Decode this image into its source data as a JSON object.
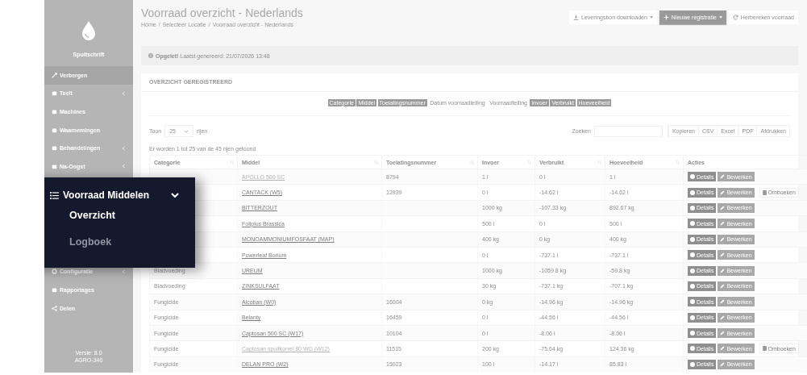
{
  "sidebar": {
    "app_name": "Spuitschrift",
    "items": [
      {
        "label": "Verbergen",
        "selected": true,
        "expandable": false
      },
      {
        "label": "Teelt",
        "selected": false,
        "expandable": true
      },
      {
        "label": "Machines",
        "selected": false,
        "expandable": false
      },
      {
        "label": "Waarnemingen",
        "selected": false,
        "expandable": false
      },
      {
        "label": "Behandelingen",
        "selected": false,
        "expandable": true
      },
      {
        "label": "Na-Oogst",
        "selected": false,
        "expandable": true
      },
      {
        "label": "Configuratie",
        "selected": false,
        "expandable": true
      },
      {
        "label": "Rapportages",
        "selected": false,
        "expandable": false
      },
      {
        "label": "Delen",
        "selected": false,
        "expandable": false
      }
    ],
    "version": "Versie: 8.0",
    "build": "AGRO-340"
  },
  "popup_menu": {
    "title": "Voorraad Middelen",
    "expanded": true,
    "items": [
      {
        "label": "Overzicht",
        "selected": true
      },
      {
        "label": "Logboek",
        "selected": false
      }
    ]
  },
  "page": {
    "title": "Voorraad overzicht - Nederlands",
    "breadcrumb_separator": "/",
    "breadcrumb": [
      "Home",
      "Selecteer Locatie",
      "Voorraad overzicht - Nederlands"
    ],
    "actions": [
      {
        "label": "Leveringsbon downloaden",
        "kind": "download"
      },
      {
        "label": "Nieuwe registratie",
        "kind": "new"
      },
      {
        "label": "Herbereken voorraad",
        "kind": "refresh"
      }
    ]
  },
  "alert": {
    "strong": "Opgelet!",
    "text": "Laatst genereerd: 21/07/2026 13:48"
  },
  "card": {
    "title": "OVERZICHT GEREGISTREERD",
    "column_toggles": [
      {
        "label": "Categorie",
        "on": true
      },
      {
        "label": "Middel",
        "on": true
      },
      {
        "label": "Toelatingsnummer",
        "on": true
      },
      {
        "label": "Datum voorraadtelling",
        "on": false
      },
      {
        "label": "Voorraadtelling",
        "on": false
      },
      {
        "label": "Invoer",
        "on": true
      },
      {
        "label": "Verbruikt",
        "on": true
      },
      {
        "label": "Hoeveelheid",
        "on": true
      }
    ],
    "length": {
      "prefix": "Toon",
      "value": "25",
      "suffix": "rijen"
    },
    "search": {
      "label": "Zoeken"
    },
    "exports": [
      "Kopieren",
      "CSV",
      "Excel",
      "PDF",
      "Afdrukken"
    ],
    "info": "Er worden 1 tot 25 van de 45 rijen getoond"
  },
  "table": {
    "columns": [
      "Categorie",
      "Middel",
      "Toelatingsnummer",
      "Invoer",
      "Verbruikt",
      "Hoeveelheid",
      "Acties"
    ],
    "rows": [
      {
        "categorie": "",
        "middel": "APOLLO 500 SC",
        "faded": true,
        "toelatingsnummer": "8794",
        "invoer": "1 l",
        "verbruikt": "0 l",
        "hoeveelheid": "1 l",
        "actions": [
          {
            "label": "Details",
            "kind": "details"
          },
          {
            "label": "Bewerken",
            "kind": "edit"
          }
        ]
      },
      {
        "categorie": "",
        "middel": "CANTACK (W5)",
        "faded": false,
        "toelatingsnummer": "12939",
        "invoer": "0 l",
        "verbruikt": "-14.62 l",
        "hoeveelheid": "-14.62 l",
        "actions": [
          {
            "label": "Details",
            "kind": "details"
          },
          {
            "label": "Bewerken",
            "kind": "edit"
          },
          {
            "label": "Omboeken",
            "kind": "transfer"
          }
        ]
      },
      {
        "categorie": "",
        "middel": "BITTERZOUT",
        "faded": false,
        "toelatingsnummer": "",
        "invoer": "1000 kg",
        "verbruikt": "-107.33 kg",
        "hoeveelheid": "892.67 kg",
        "actions": [
          {
            "label": "Details",
            "kind": "details"
          },
          {
            "label": "Bewerken",
            "kind": "edit"
          }
        ]
      },
      {
        "categorie": "",
        "middel": "Foliplus Brassica",
        "faded": false,
        "toelatingsnummer": "",
        "invoer": "500 l",
        "verbruikt": "0 l",
        "hoeveelheid": "500 l",
        "actions": [
          {
            "label": "Details",
            "kind": "details"
          },
          {
            "label": "Bewerken",
            "kind": "edit"
          }
        ]
      },
      {
        "categorie": "",
        "middel": "MONOAMMONIUMFOSFAAT (MAP)",
        "faded": false,
        "toelatingsnummer": "",
        "invoer": "400 kg",
        "verbruikt": "0 kg",
        "hoeveelheid": "400 kg",
        "actions": [
          {
            "label": "Details",
            "kind": "details"
          },
          {
            "label": "Bewerken",
            "kind": "edit"
          }
        ]
      },
      {
        "categorie": "",
        "middel": "Powerleaf Borium",
        "faded": false,
        "toelatingsnummer": "",
        "invoer": "0 l",
        "verbruikt": "-737.1 l",
        "hoeveelheid": "-737.1 l",
        "actions": [
          {
            "label": "Details",
            "kind": "details"
          },
          {
            "label": "Bewerken",
            "kind": "edit"
          }
        ]
      },
      {
        "categorie": "Bladvoeding",
        "middel": "UREUM",
        "faded": false,
        "toelatingsnummer": "",
        "invoer": "1000 kg",
        "verbruikt": "-1059.8 kg",
        "hoeveelheid": "-59.8 kg",
        "actions": [
          {
            "label": "Details",
            "kind": "details"
          },
          {
            "label": "Bewerken",
            "kind": "edit"
          }
        ]
      },
      {
        "categorie": "Bladvoeding",
        "middel": "ZINKSULFAAT",
        "faded": false,
        "toelatingsnummer": "",
        "invoer": "30 kg",
        "verbruikt": "-737.1 kg",
        "hoeveelheid": "-707.1 kg",
        "actions": [
          {
            "label": "Details",
            "kind": "details"
          },
          {
            "label": "Bewerken",
            "kind": "edit"
          }
        ]
      },
      {
        "categorie": "Fungicide",
        "middel": "Alcoban (W0)",
        "faded": false,
        "toelatingsnummer": "16004",
        "invoer": "0 kg",
        "verbruikt": "-14.96 kg",
        "hoeveelheid": "-14.96 kg",
        "actions": [
          {
            "label": "Details",
            "kind": "details"
          },
          {
            "label": "Bewerken",
            "kind": "edit"
          }
        ]
      },
      {
        "categorie": "Fungicide",
        "middel": "Belanty",
        "faded": false,
        "toelatingsnummer": "16459",
        "invoer": "0 l",
        "verbruikt": "-44.56 l",
        "hoeveelheid": "-44.56 l",
        "actions": [
          {
            "label": "Details",
            "kind": "details"
          },
          {
            "label": "Bewerken",
            "kind": "edit"
          }
        ]
      },
      {
        "categorie": "Fungicide",
        "middel": "Captosan 500 SC (W17)",
        "faded": false,
        "toelatingsnummer": "10104",
        "invoer": "0 l",
        "verbruikt": "-8.06 l",
        "hoeveelheid": "-8.06 l",
        "actions": [
          {
            "label": "Details",
            "kind": "details"
          },
          {
            "label": "Bewerken",
            "kind": "edit"
          }
        ]
      },
      {
        "categorie": "Fungicide",
        "middel": "Captosan spuitkorrel 80 WG (W12)",
        "faded": true,
        "toelatingsnummer": "11515",
        "invoer": "200 kg",
        "verbruikt": "-75.64 kg",
        "hoeveelheid": "124.36 kg",
        "actions": [
          {
            "label": "Details",
            "kind": "details"
          },
          {
            "label": "Bewerken",
            "kind": "edit"
          },
          {
            "label": "Omboeken",
            "kind": "transfer"
          }
        ]
      },
      {
        "categorie": "Fungicide",
        "middel": "DELAN PRO (W2)",
        "faded": false,
        "toelatingsnummer": "15023",
        "invoer": "100 l",
        "verbruikt": "-14.17 l",
        "hoeveelheid": "85.83 l",
        "actions": [
          {
            "label": "Details",
            "kind": "details"
          },
          {
            "label": "Bewerken",
            "kind": "edit"
          }
        ]
      }
    ]
  }
}
